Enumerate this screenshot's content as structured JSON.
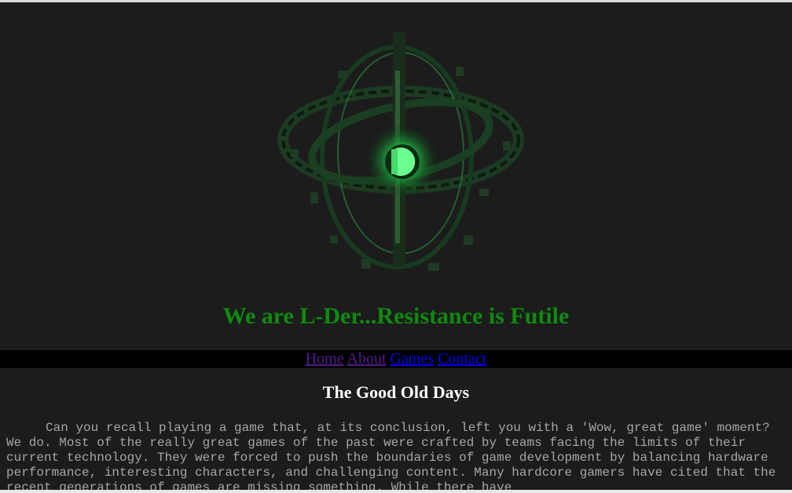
{
  "tagline": "We are L-Der...Resistance is Futile",
  "nav": {
    "home": "Home",
    "about": "About",
    "games": "Games",
    "contact": "Contact"
  },
  "section": {
    "title": "The Good Old Days",
    "paragraph": "Can you recall playing a game that, at its conclusion, left you with a 'Wow, great game' moment? We do. Most of the really great games of the past were crafted by teams facing the limits of their current technology. They were forced to push the boundaries of game development by balancing hardware performance, interesting characters, and challenging content. Many hardcore gamers have cited that the recent generations of games are missing something. While there have"
  },
  "colors": {
    "background": "#1c1c1c",
    "tagline": "#0f8a0f",
    "nav_background": "#000000",
    "link_visited": "#551a8b",
    "link": "#0000ee",
    "logo_glow": "#3cf06a"
  },
  "icons": {
    "logo": "l-der-green-orbit-logo"
  }
}
